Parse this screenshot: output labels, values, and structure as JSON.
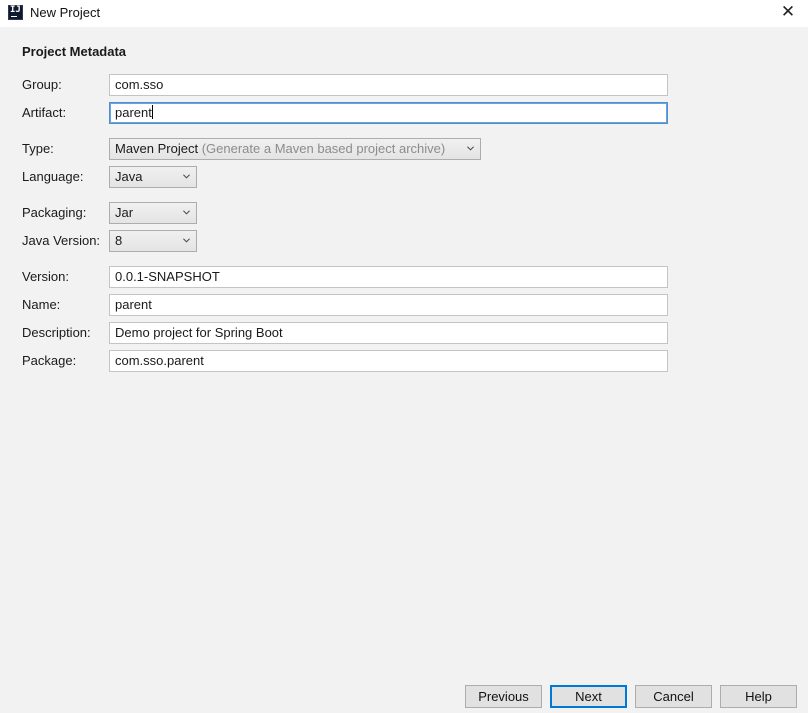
{
  "window": {
    "title": "New Project",
    "icon_text": "IJ",
    "close_glyph": "✕"
  },
  "section_title": "Project Metadata",
  "fields": {
    "group": {
      "label": "Group:",
      "value": "com.sso"
    },
    "artifact": {
      "label": "Artifact:",
      "value": "parent"
    },
    "type": {
      "label": "Type:",
      "value": "Maven Project",
      "hint": "(Generate a Maven based project archive)"
    },
    "language": {
      "label": "Language:",
      "value": "Java"
    },
    "packaging": {
      "label": "Packaging:",
      "value": "Jar"
    },
    "java_version": {
      "label": "Java Version:",
      "value": "8"
    },
    "version": {
      "label": "Version:",
      "value": "0.0.1-SNAPSHOT"
    },
    "name": {
      "label": "Name:",
      "value": "parent"
    },
    "description": {
      "label": "Description:",
      "value": "Demo project for Spring Boot"
    },
    "package": {
      "label": "Package:",
      "value": "com.sso.parent"
    }
  },
  "buttons": {
    "previous": "Previous",
    "next": "Next",
    "cancel": "Cancel",
    "help": "Help"
  },
  "icons": {
    "app": "intellij-icon",
    "close": "close-icon",
    "dropdown": "chevron-down-icon"
  },
  "colors": {
    "focus_border": "#4d8fcf",
    "default_button_border": "#0078d7",
    "background": "#f2f2f2"
  }
}
